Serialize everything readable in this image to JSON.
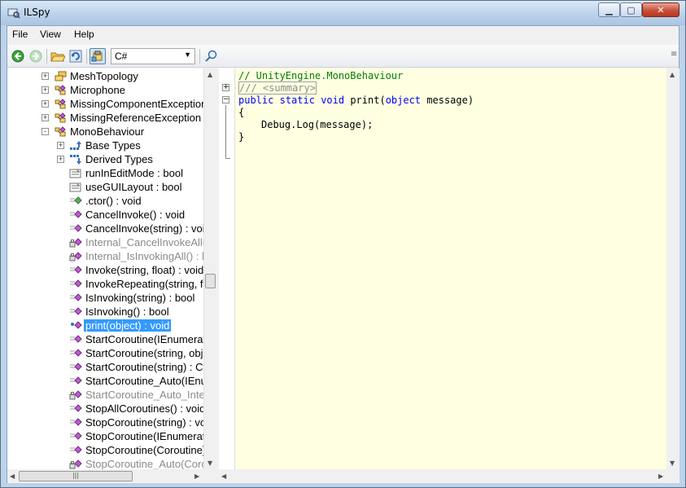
{
  "window": {
    "title": "ILSpy"
  },
  "menu": {
    "file": "File",
    "view": "View",
    "help": "Help"
  },
  "toolbar": {
    "language": "C#"
  },
  "tree": [
    {
      "label": "MeshTopology",
      "icon": "enum-icon",
      "exp": "+",
      "indent": 0,
      "style": ""
    },
    {
      "label": "Microphone",
      "icon": "class-icon",
      "exp": "+",
      "indent": 0,
      "style": ""
    },
    {
      "label": "MissingComponentException",
      "icon": "class-icon",
      "exp": "+",
      "indent": 0,
      "style": ""
    },
    {
      "label": "MissingReferenceException",
      "icon": "class-icon",
      "exp": "+",
      "indent": 0,
      "style": ""
    },
    {
      "label": "MonoBehaviour",
      "icon": "class-icon",
      "exp": "-",
      "indent": 0,
      "style": ""
    },
    {
      "label": "Base Types",
      "icon": "base-types-icon",
      "exp": "+",
      "indent": 1,
      "style": ""
    },
    {
      "label": "Derived Types",
      "icon": "derived-types-icon",
      "exp": "+",
      "indent": 1,
      "style": ""
    },
    {
      "label": "runInEditMode : bool",
      "icon": "property-icon",
      "exp": "",
      "indent": 1,
      "style": ""
    },
    {
      "label": "useGUILayout : bool",
      "icon": "property-icon",
      "exp": "",
      "indent": 1,
      "style": ""
    },
    {
      "label": ".ctor() : void",
      "icon": "constructor-icon",
      "exp": "",
      "indent": 1,
      "style": ""
    },
    {
      "label": "CancelInvoke() : void",
      "icon": "method-icon",
      "exp": "",
      "indent": 1,
      "style": ""
    },
    {
      "label": "CancelInvoke(string) : void",
      "icon": "method-icon",
      "exp": "",
      "indent": 1,
      "style": ""
    },
    {
      "label": "Internal_CancelInvokeAll() : void",
      "icon": "private-method-icon",
      "exp": "",
      "indent": 1,
      "style": "grey"
    },
    {
      "label": "Internal_IsInvokingAll() : bool",
      "icon": "private-method-icon",
      "exp": "",
      "indent": 1,
      "style": "grey"
    },
    {
      "label": "Invoke(string, float) : void",
      "icon": "method-icon",
      "exp": "",
      "indent": 1,
      "style": ""
    },
    {
      "label": "InvokeRepeating(string, float, float) : void",
      "icon": "method-icon",
      "exp": "",
      "indent": 1,
      "style": ""
    },
    {
      "label": "IsInvoking(string) : bool",
      "icon": "method-icon",
      "exp": "",
      "indent": 1,
      "style": ""
    },
    {
      "label": "IsInvoking() : bool",
      "icon": "method-icon",
      "exp": "",
      "indent": 1,
      "style": ""
    },
    {
      "label": "print(object) : void",
      "icon": "static-method-icon",
      "exp": "",
      "indent": 1,
      "style": "selected"
    },
    {
      "label": "StartCoroutine(IEnumerator) : Coroutine",
      "icon": "method-icon",
      "exp": "",
      "indent": 1,
      "style": ""
    },
    {
      "label": "StartCoroutine(string, object) : Coroutine",
      "icon": "method-icon",
      "exp": "",
      "indent": 1,
      "style": ""
    },
    {
      "label": "StartCoroutine(string) : Coroutine",
      "icon": "method-icon",
      "exp": "",
      "indent": 1,
      "style": ""
    },
    {
      "label": "StartCoroutine_Auto(IEnumerator) : Coroutine",
      "icon": "method-icon",
      "exp": "",
      "indent": 1,
      "style": ""
    },
    {
      "label": "StartCoroutine_Auto_Internal(IEnumerator) : Coroutine",
      "icon": "private-method-icon",
      "exp": "",
      "indent": 1,
      "style": "grey"
    },
    {
      "label": "StopAllCoroutines() : void",
      "icon": "method-icon",
      "exp": "",
      "indent": 1,
      "style": ""
    },
    {
      "label": "StopCoroutine(string) : void",
      "icon": "method-icon",
      "exp": "",
      "indent": 1,
      "style": ""
    },
    {
      "label": "StopCoroutine(IEnumerator) : void",
      "icon": "method-icon",
      "exp": "",
      "indent": 1,
      "style": ""
    },
    {
      "label": "StopCoroutine(Coroutine) : void",
      "icon": "method-icon",
      "exp": "",
      "indent": 1,
      "style": ""
    },
    {
      "label": "StopCoroutine_Auto(Coroutine) : void",
      "icon": "private-method-icon",
      "exp": "",
      "indent": 1,
      "style": "grey"
    }
  ],
  "code": {
    "line1": "// UnityEngine.MonoBehaviour",
    "line2": "/// <summary>",
    "kw_public": "public",
    "kw_static": "static",
    "kw_void": "void",
    "method_name": "print",
    "open_paren": "(",
    "kw_object": "object",
    "param": " message)",
    "brace_open": "{",
    "call_target": "Debug.",
    "call_method": "Log",
    "call_args": "(message);",
    "brace_close": "}"
  },
  "colors": {
    "selection": "#3399ff",
    "editor_bg": "#ffffe1",
    "keyword": "#0000ff",
    "comment": "#008000"
  }
}
